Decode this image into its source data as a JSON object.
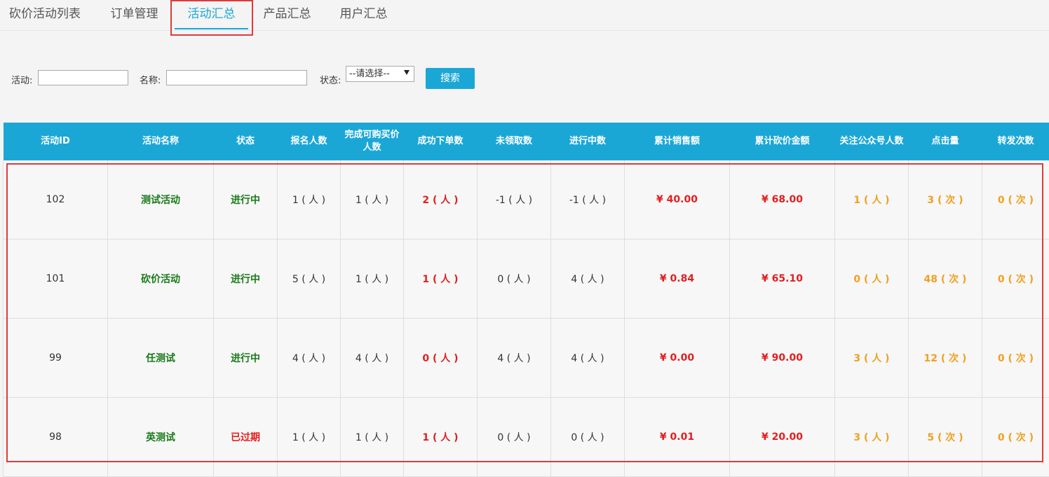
{
  "tabs": [
    {
      "label": "砍价活动列表",
      "active": false
    },
    {
      "label": "订单管理",
      "active": false
    },
    {
      "label": "活动汇总",
      "active": true
    },
    {
      "label": "产品汇总",
      "active": false
    },
    {
      "label": "用户汇总",
      "active": false
    }
  ],
  "filters": {
    "activity_label": "活动:",
    "activity_value": "",
    "name_label": "名称:",
    "name_value": "",
    "status_label": "状态:",
    "status_selected": "--请选择--",
    "search_label": "搜索"
  },
  "table": {
    "headers": [
      "活动ID",
      "活动名称",
      "状态",
      "报名人数",
      "完成可购买价人数",
      "成功下单数",
      "未领取数",
      "进行中数",
      "累计销售额",
      "累计砍价金额",
      "关注公众号人数",
      "点击量",
      "转发次数"
    ],
    "rows": [
      [
        "102",
        "测试活动",
        "进行中",
        "1 ( 人 )",
        "1 ( 人 )",
        "2 ( 人 )",
        "-1 ( 人 )",
        "-1 ( 人 )",
        "¥ 40.00",
        "¥ 68.00",
        "1 ( 人 )",
        "3 ( 次 )",
        "0 ( 次 )"
      ],
      [
        "101",
        "砍价活动",
        "进行中",
        "5 ( 人 )",
        "1 ( 人 )",
        "1 ( 人 )",
        "0 ( 人 )",
        "4 ( 人 )",
        "¥ 0.84",
        "¥ 65.10",
        "0 ( 人 )",
        "48 ( 次 )",
        "0 ( 次 )"
      ],
      [
        "99",
        "任测试",
        "进行中",
        "4 ( 人 )",
        "4 ( 人 )",
        "0 ( 人 )",
        "4 ( 人 )",
        "4 ( 人 )",
        "¥ 0.00",
        "¥ 90.00",
        "3 ( 人 )",
        "12 ( 次 )",
        "0 ( 次 )"
      ],
      [
        "98",
        "英测试",
        "已过期",
        "1 ( 人 )",
        "1 ( 人 )",
        "1 ( 人 )",
        "0 ( 人 )",
        "0 ( 人 )",
        "¥ 0.01",
        "¥ 20.00",
        "3 ( 人 )",
        "5 ( 次 )",
        "0 ( 次 )"
      ]
    ]
  },
  "colors": {
    "accent": "#1ba7d6",
    "highlight": "#e03a3a",
    "status_active": "#1a7a1a",
    "status_expired": "#e02020",
    "money": "#e02020",
    "count_orange": "#f0a020"
  }
}
